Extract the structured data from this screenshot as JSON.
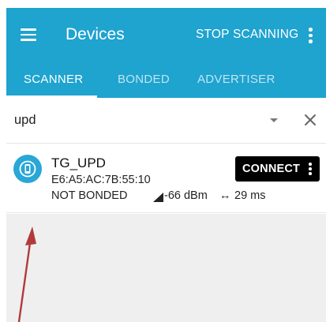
{
  "toolbar": {
    "title": "Devices",
    "action_label": "STOP SCANNING"
  },
  "tabs": [
    {
      "label": "SCANNER",
      "active": true
    },
    {
      "label": "BONDED",
      "active": false
    },
    {
      "label": "ADVERTISER",
      "active": false
    }
  ],
  "filter": {
    "value": "upd"
  },
  "devices": [
    {
      "name": "TG_UPD",
      "mac": "E6:A5:AC:7B:55:10",
      "bond_state": "NOT BONDED",
      "rssi": "-66 dBm",
      "interval": "29 ms",
      "connect_label": "CONNECT"
    }
  ],
  "colors": {
    "appbar": "#1fa3cf",
    "device_icon": "#29a7d6",
    "connect_button": "#000000",
    "empty_area": "#efefef",
    "annotation_arrow": "#b23a3a"
  }
}
